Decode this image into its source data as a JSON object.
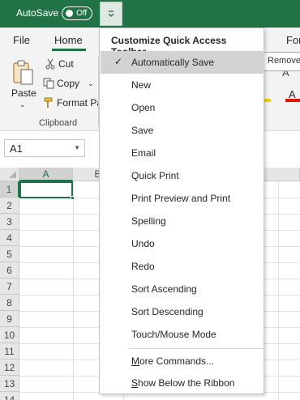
{
  "titlebar": {
    "autosave_label": "AutoSave",
    "toggle_text": "Off",
    "qat_button_icon": "customize-chevron-icon",
    "colors": {
      "bar": "#217346"
    }
  },
  "ribbon_tabs": {
    "file": "File",
    "home": "Home",
    "formulas_partial": "For"
  },
  "clipboard": {
    "paste": "Paste",
    "cut": "Cut",
    "copy": "Copy",
    "format_painter": "Format Pa",
    "group_label": "Clipboard"
  },
  "tooltip": {
    "text": "Remove"
  },
  "namebox": {
    "value": "A1"
  },
  "grid": {
    "columns": [
      "A",
      "B"
    ],
    "rows": [
      "1",
      "2",
      "3",
      "4",
      "5",
      "6",
      "7",
      "8",
      "9",
      "10",
      "11",
      "12",
      "13",
      "14"
    ]
  },
  "menu": {
    "title": "Customize Quick Access Toolbar",
    "items": [
      {
        "label": "Automatically Save",
        "checked": true
      },
      {
        "label": "New"
      },
      {
        "label": "Open"
      },
      {
        "label": "Save"
      },
      {
        "label": "Email"
      },
      {
        "label": "Quick Print"
      },
      {
        "label": "Print Preview and Print"
      },
      {
        "label": "Spelling"
      },
      {
        "label": "Undo"
      },
      {
        "label": "Redo"
      },
      {
        "label": "Sort Ascending"
      },
      {
        "label": "Sort Descending"
      },
      {
        "label": "Touch/Mouse Mode"
      }
    ],
    "more_commands": {
      "prefix": "M",
      "rest": "ore Commands..."
    },
    "show_below": {
      "prefix": "S",
      "rest": "how Below the Ribbon"
    }
  }
}
